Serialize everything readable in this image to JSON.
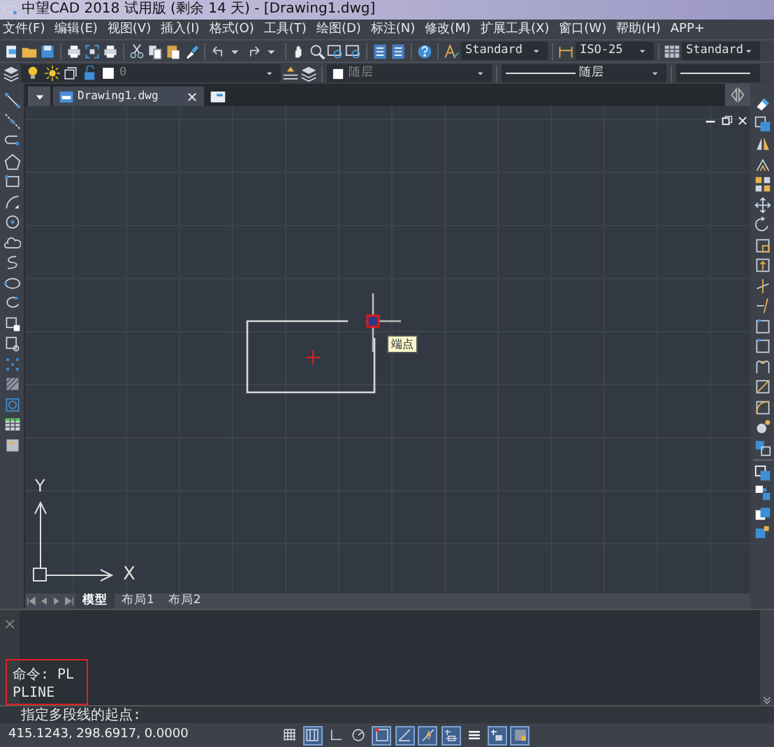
{
  "window": {
    "title": "中望CAD 2018 试用版 (剩余 14 天) - [Drawing1.dwg]"
  },
  "menu": [
    "文件(F)",
    "编辑(E)",
    "视图(V)",
    "插入(I)",
    "格式(O)",
    "工具(T)",
    "绘图(D)",
    "标注(N)",
    "修改(M)",
    "扩展工具(X)",
    "窗口(W)",
    "帮助(H)",
    "APP+"
  ],
  "toolbar": {
    "text_style": "Standard",
    "dim_style": "ISO-25",
    "table_style": "Standard",
    "layer": "0",
    "color_setting": "随层",
    "linetype": "随层"
  },
  "document_tabs": [
    {
      "label": "Drawing1.dwg",
      "selected": true
    }
  ],
  "canvas": {
    "tooltip": "端点",
    "ucs": {
      "x_label": "X",
      "y_label": "Y"
    }
  },
  "layout_tabs": [
    {
      "label": "模型",
      "selected": true
    },
    {
      "label": "布局1",
      "selected": false
    },
    {
      "label": "布局2",
      "selected": false
    }
  ],
  "command_history": [
    "命令: PL",
    "PLINE"
  ],
  "prompt": "指定多段线的起点:",
  "status_bar": {
    "coordinates": "415.1243, 298.6917, 0.0000",
    "toggles": [
      {
        "on": false
      },
      {
        "on": true
      },
      {
        "on": false
      },
      {
        "on": false
      },
      {
        "on": true
      },
      {
        "on": true
      },
      {
        "on": true
      },
      {
        "on": true
      },
      {
        "on": false
      },
      {
        "on": true
      },
      {
        "on": true
      }
    ]
  }
}
